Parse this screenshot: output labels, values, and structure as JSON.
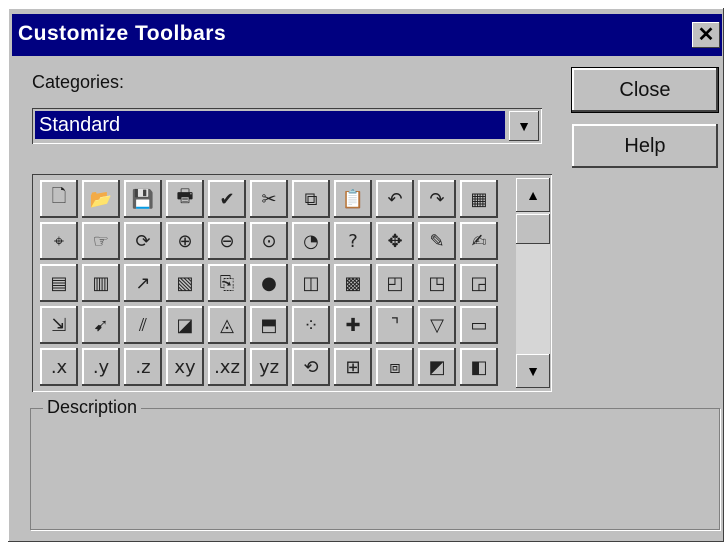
{
  "window": {
    "title": "Customize Toolbars",
    "close_glyph": "✕"
  },
  "categories": {
    "label": "Categories:",
    "value": "Standard",
    "arrow_glyph": "▼"
  },
  "buttons": {
    "close": "Close",
    "help": "Help"
  },
  "icon_grid": {
    "rows": [
      [
        {
          "name": "new-document-icon",
          "glyph": "🗋"
        },
        {
          "name": "open-folder-icon",
          "glyph": "📂"
        },
        {
          "name": "save-disk-icon",
          "glyph": "💾"
        },
        {
          "name": "print-icon",
          "glyph": "🖶"
        },
        {
          "name": "spellcheck-icon",
          "glyph": "✔"
        },
        {
          "name": "cut-scissors-icon",
          "glyph": "✂"
        },
        {
          "name": "copy-icon",
          "glyph": "⧉"
        },
        {
          "name": "paste-icon",
          "glyph": "📋"
        },
        {
          "name": "undo-icon",
          "glyph": "↶"
        },
        {
          "name": "redo-icon",
          "glyph": "↷"
        },
        {
          "name": "calculator-icon",
          "glyph": "▦"
        }
      ],
      [
        {
          "name": "select-objects-icon",
          "glyph": "⌖"
        },
        {
          "name": "select-hand-icon",
          "glyph": "☞"
        },
        {
          "name": "rotate-view-icon",
          "glyph": "⟳"
        },
        {
          "name": "zoom-in-icon",
          "glyph": "⊕"
        },
        {
          "name": "zoom-out-icon",
          "glyph": "⊖"
        },
        {
          "name": "zoom-window-icon",
          "glyph": "⊙"
        },
        {
          "name": "zoom-dynamic-icon",
          "glyph": "◔"
        },
        {
          "name": "help-question-icon",
          "text": "?"
        },
        {
          "name": "pan-move-icon",
          "glyph": "✥"
        },
        {
          "name": "edit-pencil-icon",
          "glyph": "✎"
        },
        {
          "name": "edit-notes-icon",
          "glyph": "✍"
        }
      ],
      [
        {
          "name": "table-icon",
          "glyph": "▤"
        },
        {
          "name": "columns-icon",
          "glyph": "▥"
        },
        {
          "name": "graph-icon",
          "glyph": "↗"
        },
        {
          "name": "data-sheet-icon",
          "glyph": "▧"
        },
        {
          "name": "attach-icon",
          "glyph": "⎘"
        },
        {
          "name": "run-green-icon",
          "glyph": "●"
        },
        {
          "name": "split-view-icon",
          "glyph": "◫"
        },
        {
          "name": "color-chart-icon",
          "glyph": "▩"
        },
        {
          "name": "layers-icon",
          "glyph": "◰"
        },
        {
          "name": "inspect-icon",
          "glyph": "◳"
        },
        {
          "name": "select-region-icon",
          "glyph": "◲"
        }
      ],
      [
        {
          "name": "transform-icon",
          "glyph": "⇲"
        },
        {
          "name": "pointer-red-icon",
          "glyph": "➹"
        },
        {
          "name": "hatch-select-icon",
          "glyph": "⫽"
        },
        {
          "name": "page-select-icon",
          "glyph": "◪"
        },
        {
          "name": "triangle-select-icon",
          "glyph": "◬"
        },
        {
          "name": "region-select-icon",
          "glyph": "⬒"
        },
        {
          "name": "scatter-select-icon",
          "glyph": "⁘"
        },
        {
          "name": "add-point-icon",
          "glyph": "✚"
        },
        {
          "name": "corner-line-icon",
          "glyph": "⌝"
        },
        {
          "name": "filter-funnel-icon",
          "glyph": "▽"
        },
        {
          "name": "clipboard-blank-icon",
          "glyph": "▭"
        }
      ],
      [
        {
          "name": "axis-x-icon",
          "text": ".x"
        },
        {
          "name": "axis-y-icon",
          "text": ".y"
        },
        {
          "name": "axis-z-icon",
          "text": ".z"
        },
        {
          "name": "plane-xy-icon",
          "text": "xy"
        },
        {
          "name": "plane-xz-icon",
          "text": ".xz"
        },
        {
          "name": "plane-yz-icon",
          "text": "yz"
        },
        {
          "name": "view-3d-rotate-icon",
          "glyph": "⟲"
        },
        {
          "name": "view-3d-grid-icon",
          "glyph": "⊞"
        },
        {
          "name": "view-3d-layers-icon",
          "glyph": "⧈"
        },
        {
          "name": "cube-icon",
          "glyph": "◩"
        },
        {
          "name": "cube-solid-icon",
          "glyph": "◧"
        }
      ]
    ]
  },
  "scrollbar": {
    "up_glyph": "▲",
    "down_glyph": "▼"
  },
  "description": {
    "label": "Description"
  }
}
